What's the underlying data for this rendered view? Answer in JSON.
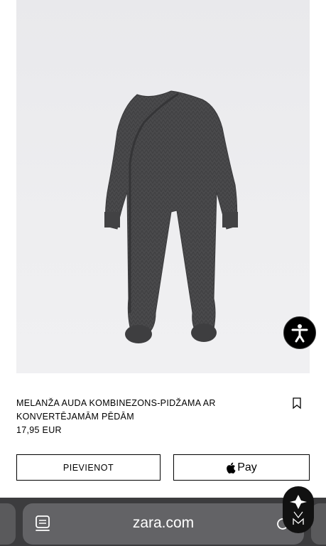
{
  "product": {
    "title": "MELANŽA AUDA KOMBINEZONS-PIDŽAMA AR KONVERTĒJAMĀM PĒDĀM",
    "price": "17,95 EUR",
    "image_alt": "Dark grey knit baby sleepsuit with footies"
  },
  "actions": {
    "add_label": "PIEVIENOT",
    "applepay_label": "Pay",
    "applepay_logo": "apple-logo-icon"
  },
  "browser": {
    "address": "zara.com",
    "tabs_icon": "tabs-icon",
    "reload_icon": "reload-icon"
  },
  "icons": {
    "accessibility": "accessibility-icon",
    "bookmark": "bookmark-icon",
    "brand": "brand-logo-icon"
  },
  "colors": {
    "background": "#ffffff",
    "image_background": "#ececef",
    "garment": "#4a4a4c",
    "browser_bar": "#3c3c3e",
    "address_pill": "#636366"
  }
}
